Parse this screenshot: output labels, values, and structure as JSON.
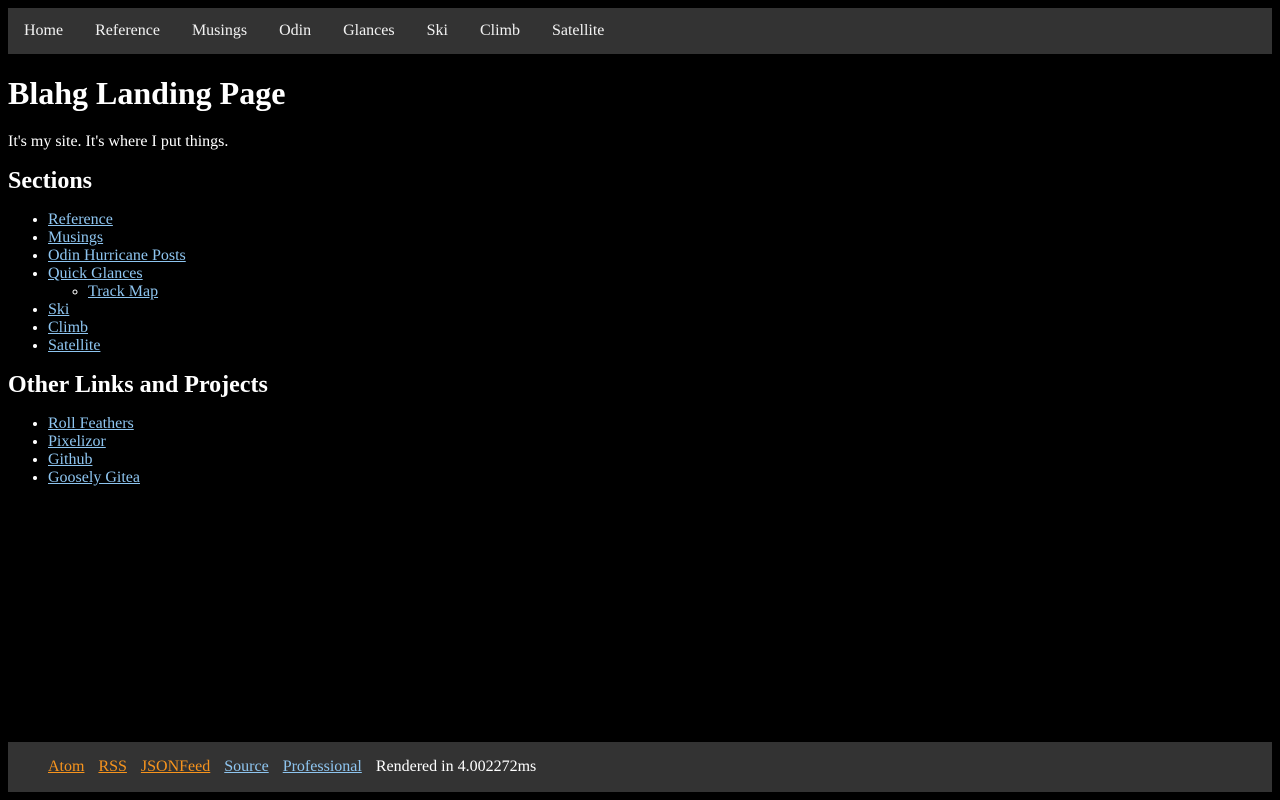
{
  "nav": {
    "items": [
      "Home",
      "Reference",
      "Musings",
      "Odin",
      "Glances",
      "Ski",
      "Climb",
      "Satellite"
    ]
  },
  "main": {
    "title": "Blahg Landing Page",
    "intro": "It's my site. It's where I put things.",
    "sections_heading": "Sections",
    "sections": {
      "reference": "Reference",
      "musings": "Musings",
      "odin": "Odin Hurricane Posts",
      "quick_glances": "Quick Glances",
      "track_map": "Track Map",
      "ski": "Ski",
      "climb": "Climb",
      "satellite": "Satellite"
    },
    "other_heading": "Other Links and Projects",
    "other": {
      "roll_feathers": "Roll Feathers",
      "pixelizor": "Pixelizor",
      "github": "Github",
      "goosely_gitea": "Goosely Gitea"
    }
  },
  "footer": {
    "atom": "Atom",
    "rss": "RSS",
    "jsonfeed": "JSONFeed",
    "source": "Source",
    "professional": "Professional",
    "rendered": "Rendered in 4.002272ms"
  },
  "colors": {
    "background": "#000000",
    "bar": "#333333",
    "link": "#8ec5f0",
    "feed_link": "#f7941d"
  }
}
